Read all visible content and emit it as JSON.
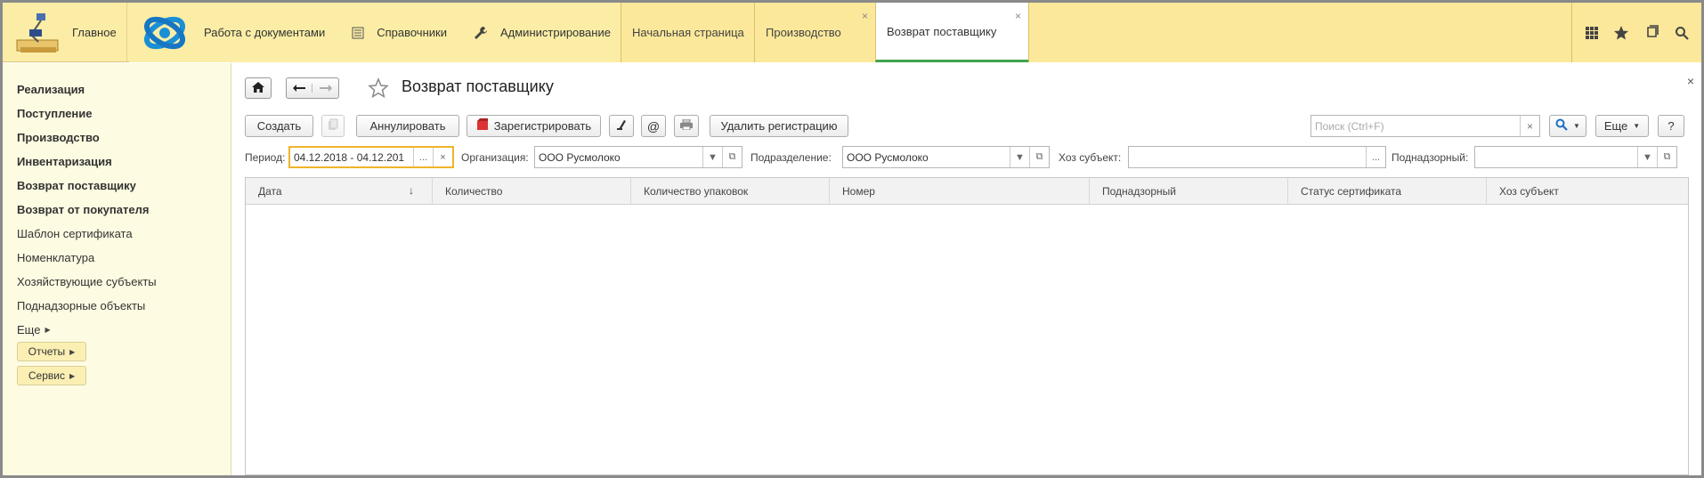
{
  "topbar": {
    "home_label": "Главное",
    "sections": [
      {
        "label": "Работа с документами",
        "icon": "app-logo"
      },
      {
        "label": "Справочники",
        "icon": "list-icon"
      },
      {
        "label": "Администрирование",
        "icon": "wrench-icon"
      }
    ],
    "tabs": [
      {
        "label": "Начальная страница",
        "closable": false,
        "active": false
      },
      {
        "label": "Производство",
        "closable": true,
        "active": false
      },
      {
        "label": "Возврат поставщику",
        "closable": true,
        "active": true
      }
    ],
    "close_glyph": "×",
    "tools": [
      "apps-grid-icon",
      "star-icon",
      "history-icon",
      "search-icon"
    ]
  },
  "sidebar": {
    "items": [
      {
        "label": "Реализация",
        "bold": true
      },
      {
        "label": "Поступление",
        "bold": true
      },
      {
        "label": "Производство",
        "bold": true
      },
      {
        "label": "Инвентаризация",
        "bold": true
      },
      {
        "label": "Возврат поставщику",
        "bold": true
      },
      {
        "label": "Возврат от покупателя",
        "bold": true
      },
      {
        "label": "Шаблон сертификата",
        "bold": false
      },
      {
        "label": "Номенклатура",
        "bold": false
      },
      {
        "label": "Хозяйствующие субъекты",
        "bold": false
      },
      {
        "label": "Поднадзорные объекты",
        "bold": false
      }
    ],
    "more_label": "Еще",
    "reports_label": "Отчеты",
    "service_label": "Сервис"
  },
  "main": {
    "title": "Возврат поставщику",
    "close_glyph": "×",
    "toolbar": {
      "create": "Создать",
      "annul": "Аннулировать",
      "register": "Зарегистрировать",
      "email": "@",
      "delete_registration": "Удалить регистрацию",
      "more": "Еще",
      "help": "?"
    },
    "search": {
      "placeholder": "Поиск (Ctrl+F)",
      "clear": "×"
    },
    "filters": {
      "period_label": "Период:",
      "period_value": "04.12.2018 - 04.12.201",
      "period_more": "...",
      "period_clear": "×",
      "org_label": "Организация:",
      "org_value": "ООО Русмолоко",
      "division_label": "Подразделение:",
      "division_value": "ООО Русмолоко",
      "entity_label": "Хоз субъект:",
      "entity_value": "",
      "entity_more": "...",
      "supervised_label": "Поднадзорный:",
      "supervised_value": ""
    },
    "table": {
      "columns": [
        "Дата",
        "Количество",
        "Количество упаковок",
        "Номер",
        "Поднадзорный",
        "Статус сертификата",
        "Хоз субъект"
      ],
      "sort_glyph": "↓",
      "rows": []
    }
  },
  "colors": {
    "topbar": "#fbeda5",
    "sidebar": "#fdfbe1",
    "active_tab_underline": "#3ea34f",
    "focus_border": "#f0b429"
  }
}
